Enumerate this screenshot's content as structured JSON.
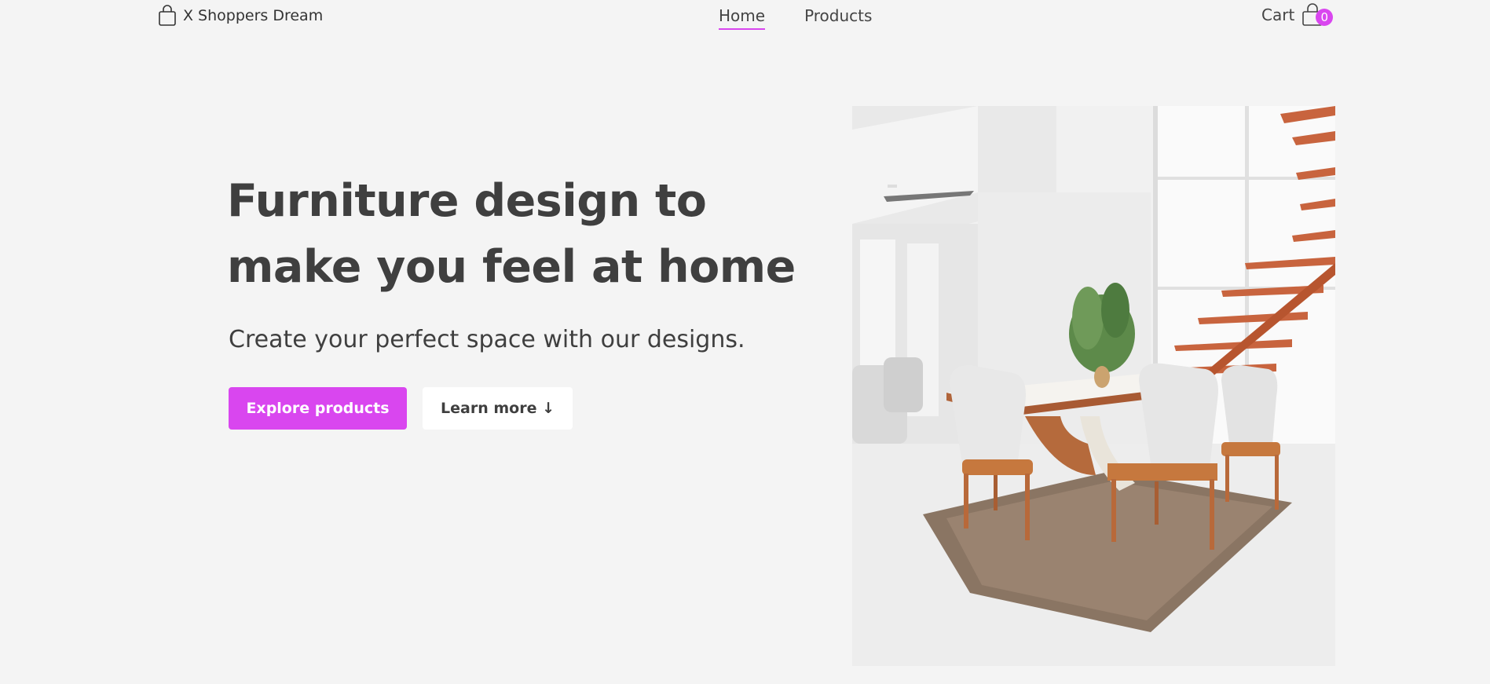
{
  "nav": {
    "brand": "X Shoppers Dream",
    "links": [
      {
        "label": "Home",
        "active": true
      },
      {
        "label": "Products",
        "active": false
      }
    ],
    "cart_label": "Cart",
    "cart_count": "0"
  },
  "hero": {
    "title_line1": "Furniture design to",
    "title_line2": "make you feel at home",
    "subtitle": "Create your perfect space with our designs.",
    "primary_button": "Explore products",
    "secondary_button": "Learn more ↓",
    "image_icon": "dining-room-photo"
  },
  "colors": {
    "accent": "#d946ef",
    "background": "#f4f4f4",
    "text": "#3f3f3f"
  }
}
